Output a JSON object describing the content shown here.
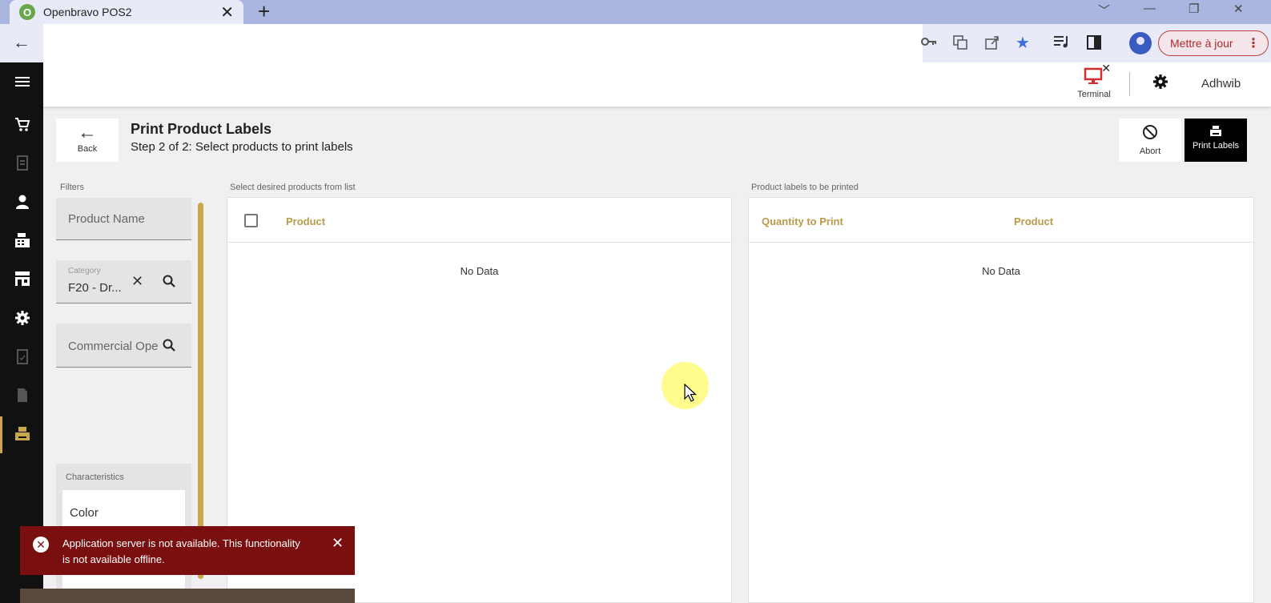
{
  "browser": {
    "tab_title": "Openbravo POS2",
    "tab_favicon_letter": "O",
    "tab_close": "✕",
    "new_tab": "+",
    "update_button": "Mettre à jour",
    "update_menu": "⋮",
    "window_controls": [
      "﹀",
      "—",
      "❐",
      "✕"
    ]
  },
  "sidebar": {
    "items": [
      {
        "icon": "menu-icon"
      },
      {
        "icon": "cart-icon"
      },
      {
        "icon": "receipt-icon",
        "dimmed": true
      },
      {
        "icon": "customer-icon"
      },
      {
        "icon": "cash-register-icon"
      },
      {
        "icon": "store-icon"
      },
      {
        "icon": "settings-icon"
      },
      {
        "icon": "report-icon",
        "dimmed": true
      },
      {
        "icon": "document-icon",
        "dimmed": true
      },
      {
        "icon": "print-labels-icon",
        "active": true
      }
    ]
  },
  "header": {
    "terminal_label": "Terminal",
    "user_name": "Adhwib"
  },
  "page": {
    "back_label": "Back",
    "title": "Print Product Labels",
    "subtitle": "Step 2 of 2: Select products to print labels",
    "abort_label": "Abort",
    "print_label": "Print Labels"
  },
  "filters": {
    "section_label": "Filters",
    "product_name_placeholder": "Product Name",
    "category_label": "Category",
    "category_value": "F20 - Dr...",
    "commercial_placeholder": "Commercial Ope",
    "characteristics_label": "Characteristics",
    "characteristic_item": "Color"
  },
  "products_table": {
    "section_label": "Select desired products from list",
    "columns": [
      "Product"
    ],
    "empty_text": "No Data"
  },
  "labels_table": {
    "section_label": "Product labels to be printed",
    "columns": [
      "Quantity to Print",
      "Product"
    ],
    "empty_text": "No Data"
  },
  "toast": {
    "message": "Application server is not available. This functionality is not available offline.",
    "type": "error"
  },
  "colors": {
    "accent": "#c9a84c",
    "column_header": "#b89a4a",
    "error_toast": "#7a0f0f",
    "terminal_icon": "#d32f2f",
    "chrome_tabbar": "#aab5e0"
  }
}
